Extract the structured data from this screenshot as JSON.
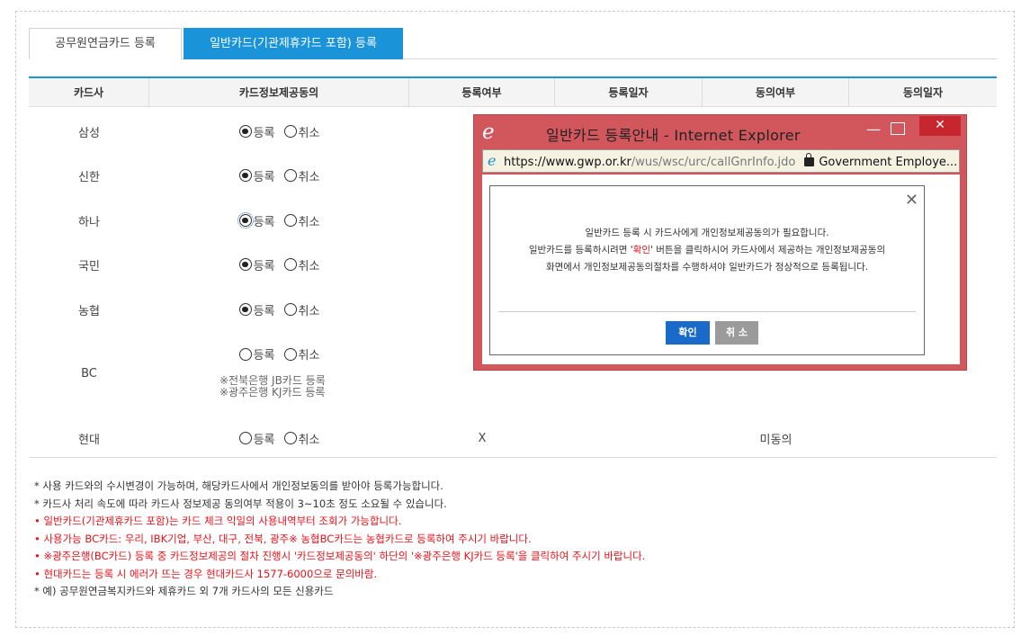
{
  "tabs": [
    {
      "label": "공무원연금카드 등록"
    },
    {
      "label": "일반카드(기관제휴카드 포함) 등록"
    }
  ],
  "table": {
    "headers": [
      "카드사",
      "카드정보제공동의",
      "등록여부",
      "등록일자",
      "동의여부",
      "동의일자"
    ],
    "radio_register": "등록",
    "radio_cancel": "취소",
    "rows": [
      {
        "name": "삼성",
        "registered_status": "",
        "consent": ""
      },
      {
        "name": "신한",
        "registered_status": "",
        "consent": ""
      },
      {
        "name": "하나",
        "registered_status": "",
        "consent": ""
      },
      {
        "name": "국민",
        "registered_status": "",
        "consent": ""
      },
      {
        "name": "농협",
        "registered_status": "",
        "consent": ""
      },
      {
        "name": "BC",
        "registered_status": "",
        "consent": ""
      },
      {
        "name": "현대",
        "registered_status": "X",
        "consent": "미동의"
      }
    ],
    "bc_note_1": "※전북은행 JB카드 등록",
    "bc_note_2": "※광주은행 KJ카드 등록"
  },
  "notes": [
    {
      "text": "* 사용 카드와의 수시변경이 가능하며, 해당카드사에서 개인정보동의를 받아야 등록가능합니다.",
      "color": "dark"
    },
    {
      "text": "* 카드사 처리 속도에 따라 카드사 정보제공 동의여부 적용이 3~10초 정도 소요될 수 있습니다.",
      "color": "dark"
    },
    {
      "text": "• 일반카드(기관제휴카드 포함)는 카드 체크 익일의 사용내역부터 조회가 가능합니다.",
      "color": "red"
    },
    {
      "text": "• 사용가능 BC카드: 우리, IBK기업, 부산, 대구, 전북, 광주※ 농협BC카드는 농협카드로 등록하여 주시기 바랍니다.",
      "color": "red"
    },
    {
      "text": "• ※광주은행(BC카드) 등록 중 카드정보제공의 절차 진행시 '카드정보제공동의' 하단의 '※광주은행 KJ카드 등록'을 클릭하여 주시기 바랍니다.",
      "color": "red"
    },
    {
      "text": "• 현대카드는 등록 시 에러가 뜨는 경우 현대카드사 1577-6000으로 문의바람.",
      "color": "red"
    },
    {
      "text": "* 예) 공무원연금복지카드와 제휴카드 외 7개 카드사의 모든 신용카드",
      "color": "dark"
    }
  ],
  "popup": {
    "title": "일반카드 등록안내 - Internet Explorer",
    "url_scheme_domain": "https://www.gwp.or.kr",
    "url_path": "/wus/wsc/urc/callGnrInfo.jdo",
    "site_org": "Government Employe...",
    "message_line1": "일반카드 등록 시 카드사에게 개인정보제공동의가 필요합니다.",
    "message_line2_a": "일반카드를 등록하시려면 '",
    "message_line2_b": "확인",
    "message_line2_c": "' 버튼을 클릭하시어 카드사에서 제공하는 개인정보제공동의",
    "message_line3": "화면에서 개인정보제공동의절차를 수행하셔야 일반카드가 정상적으로 등록됩니다.",
    "ok_label": "확인",
    "cancel_label": "취 소"
  },
  "colors": {
    "accent": "#1a93d9",
    "red_text": "#e4121b",
    "ie_frame": "#d1575d"
  }
}
